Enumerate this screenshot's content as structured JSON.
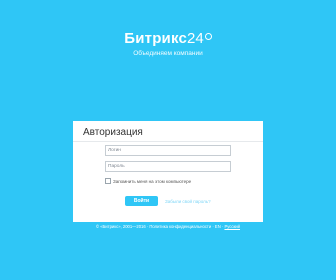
{
  "brand": {
    "name": "Битрикс",
    "num": "24",
    "slogan": "Объединяем компании"
  },
  "auth": {
    "title": "Авторизация",
    "login_value": "Логин",
    "password_value": "Пароль",
    "remember_label": "Запомнить меня на этом компьютере",
    "login_button": "Войти",
    "forgot_link": "Забыли свой пароль?"
  },
  "footer": {
    "copyright": "© «Битрикс», 2001—2016 · Политика конфиденциальности · EN ·",
    "lang": "Русский"
  },
  "colors": {
    "background": "#2fc6f6",
    "button": "#2fc6f6"
  }
}
